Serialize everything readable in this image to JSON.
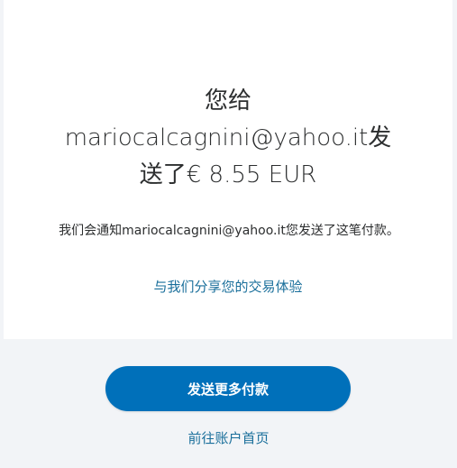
{
  "confirmation": {
    "headline_prefix": "您给",
    "recipient_email": "mariocalcagnini@yahoo.it",
    "sent_word": "发送了",
    "amount": "€ 8.55 EUR",
    "notice_text": "我们会通知mariocalcagnini@yahoo.it您发送了这笔付款。",
    "share_link_label": "与我们分享您的交易体验"
  },
  "actions": {
    "send_more_label": "发送更多付款",
    "go_account_label": "前往账户首页"
  },
  "colors": {
    "primary_button": "#0070ba",
    "link": "#1a6f9b",
    "page_background": "#f2f4f7",
    "card_background": "#ffffff"
  }
}
